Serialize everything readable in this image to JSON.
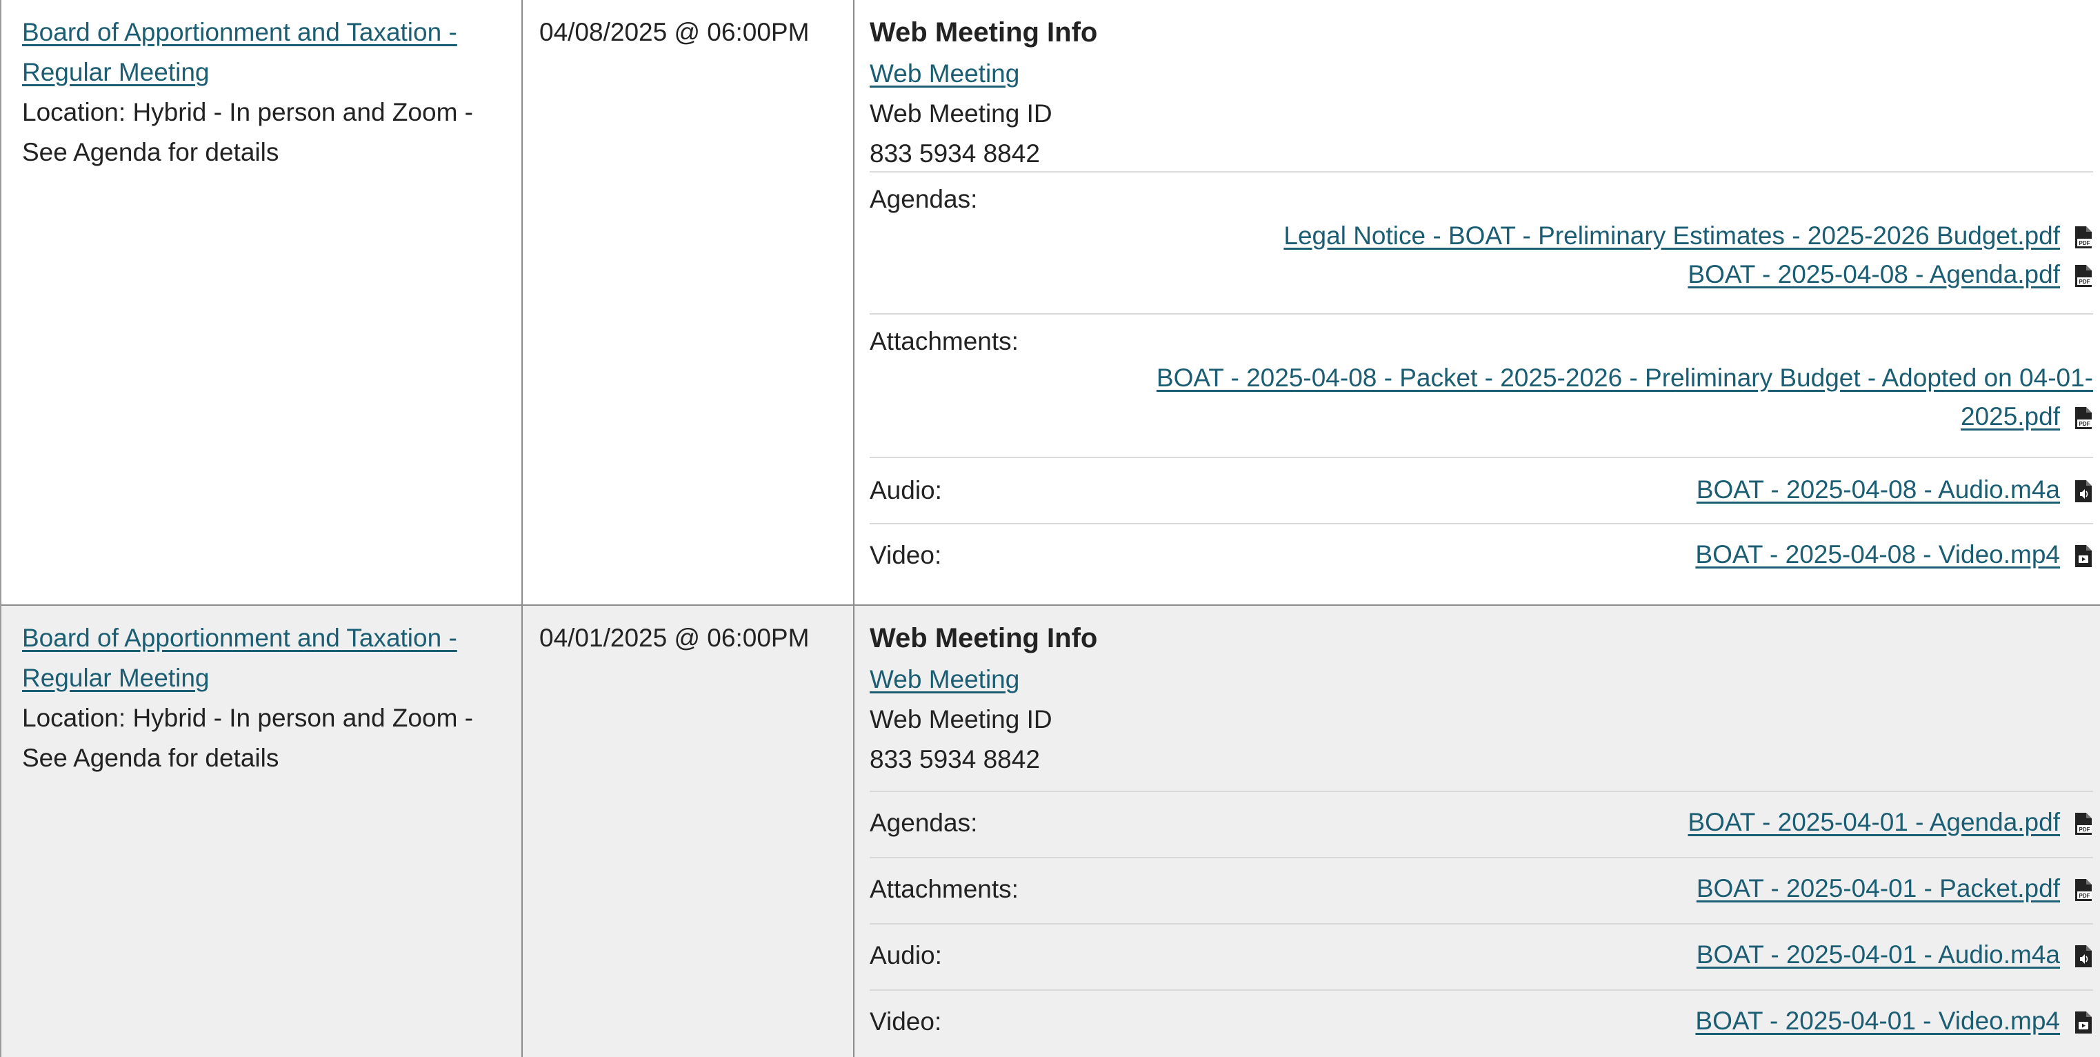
{
  "meetings": [
    {
      "title": "Board of Apportionment and Taxation - Regular Meeting",
      "location": "Location: Hybrid - In person and Zoom - See Agenda for details",
      "datetime": "04/08/2025 @ 06:00PM",
      "web_meeting_info_title": "Web Meeting Info",
      "web_meeting_link": "Web Meeting",
      "web_meeting_id_label": "Web Meeting ID",
      "web_meeting_id": "833 5934 8842",
      "agendas_label": "Agendas:",
      "agendas": [
        "Legal Notice - BOAT - Preliminary Estimates - 2025-2026 Budget.pdf",
        "BOAT - 2025-04-08 - Agenda.pdf"
      ],
      "attachments_label": "Attachments:",
      "attachments_line1": "BOAT - 2025-04-08 - Packet - 2025-2026 - Preliminary Budget - Adopted on 04-01-",
      "attachments_line2": "2025.pdf",
      "audio_label": "Audio:",
      "audio": "BOAT - 2025-04-08 - Audio.m4a",
      "video_label": "Video:",
      "video": "BOAT - 2025-04-08 - Video.mp4"
    },
    {
      "title": "Board of Apportionment and Taxation - Regular Meeting",
      "location": "Location: Hybrid - In person and Zoom - See Agenda for details",
      "datetime": "04/01/2025 @ 06:00PM",
      "web_meeting_info_title": "Web Meeting Info",
      "web_meeting_link": "Web Meeting",
      "web_meeting_id_label": "Web Meeting ID",
      "web_meeting_id": "833 5934 8842",
      "agendas_label": "Agendas:",
      "agendas": [
        "BOAT - 2025-04-01 - Agenda.pdf"
      ],
      "attachments_label": "Attachments:",
      "attachments": [
        "BOAT - 2025-04-01 - Packet.pdf"
      ],
      "audio_label": "Audio:",
      "audio": "BOAT - 2025-04-01 - Audio.m4a",
      "video_label": "Video:",
      "video": "BOAT - 2025-04-01 - Video.mp4"
    }
  ],
  "icons": {
    "pdf": "pdf-file-icon",
    "audio": "audio-file-icon",
    "video": "video-file-icon"
  },
  "colors": {
    "link": "#1b5e73",
    "row_alt_background": "#efeff0",
    "border": "#8c8c8c"
  }
}
